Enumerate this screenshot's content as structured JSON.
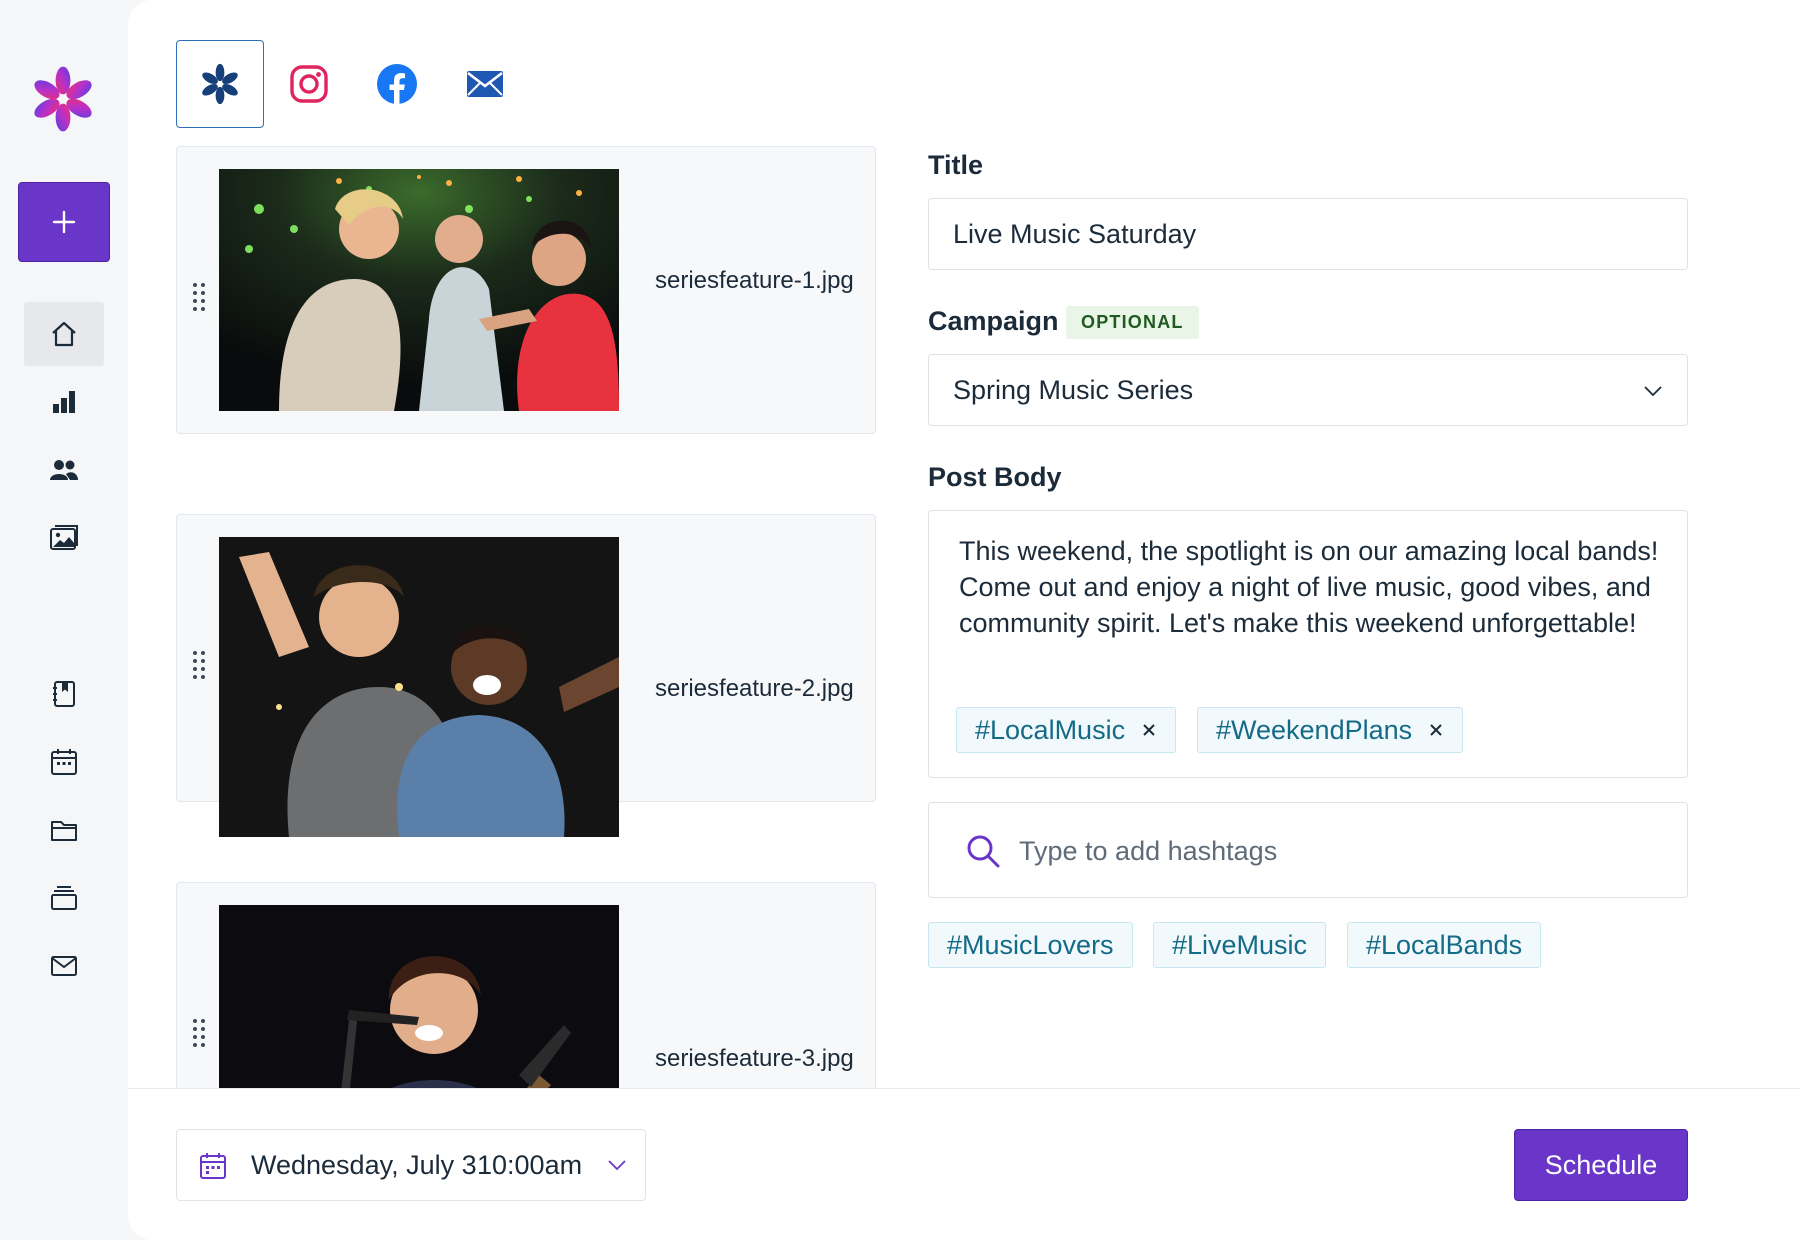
{
  "sidebar": {
    "create_button": {
      "icon": "plus-icon"
    },
    "nav_items": [
      {
        "icon": "home-icon",
        "active": true
      },
      {
        "icon": "bar-chart-icon",
        "active": false
      },
      {
        "icon": "users-icon",
        "active": false
      },
      {
        "icon": "image-gallery-icon",
        "active": false
      },
      {
        "icon": "book-icon",
        "active": false
      },
      {
        "icon": "calendar-icon",
        "active": false
      },
      {
        "icon": "folder-icon",
        "active": false
      },
      {
        "icon": "stack-icon",
        "active": false
      },
      {
        "icon": "mail-icon",
        "active": false
      }
    ]
  },
  "channels": [
    {
      "icon": "brand-pinwheel-icon",
      "active": true
    },
    {
      "icon": "instagram-icon",
      "active": false
    },
    {
      "icon": "facebook-icon",
      "active": false
    },
    {
      "icon": "email-icon",
      "active": false
    }
  ],
  "media": [
    {
      "filename": "seriesfeature-1.jpg"
    },
    {
      "filename": "seriesfeature-2.jpg"
    },
    {
      "filename": "seriesfeature-3.jpg"
    }
  ],
  "form": {
    "title_label": "Title",
    "title_value": "Live Music Saturday",
    "campaign_label": "Campaign",
    "campaign_badge": "OPTIONAL",
    "campaign_value": "Spring Music Series",
    "body_label": "Post Body",
    "body_text": "This weekend, the spotlight is on our amazing local bands! Come out and enjoy a night of live music, good vibes, and community spirit. Let's make this weekend unforgettable!",
    "applied_tags": [
      "#LocalMusic",
      "#WeekendPlans"
    ],
    "hashtag_placeholder": "Type to add hashtags",
    "suggested_tags": [
      "#MusicLovers",
      "#LiveMusic",
      "#LocalBands"
    ]
  },
  "footer": {
    "date": "Wednesday, July 3",
    "time": "10:00am",
    "schedule_label": "Schedule"
  },
  "colors": {
    "primary": "#6a35c9",
    "tag_text": "#146b87",
    "tag_bg": "#f2f9fc",
    "badge_bg": "#e8f5e7"
  }
}
